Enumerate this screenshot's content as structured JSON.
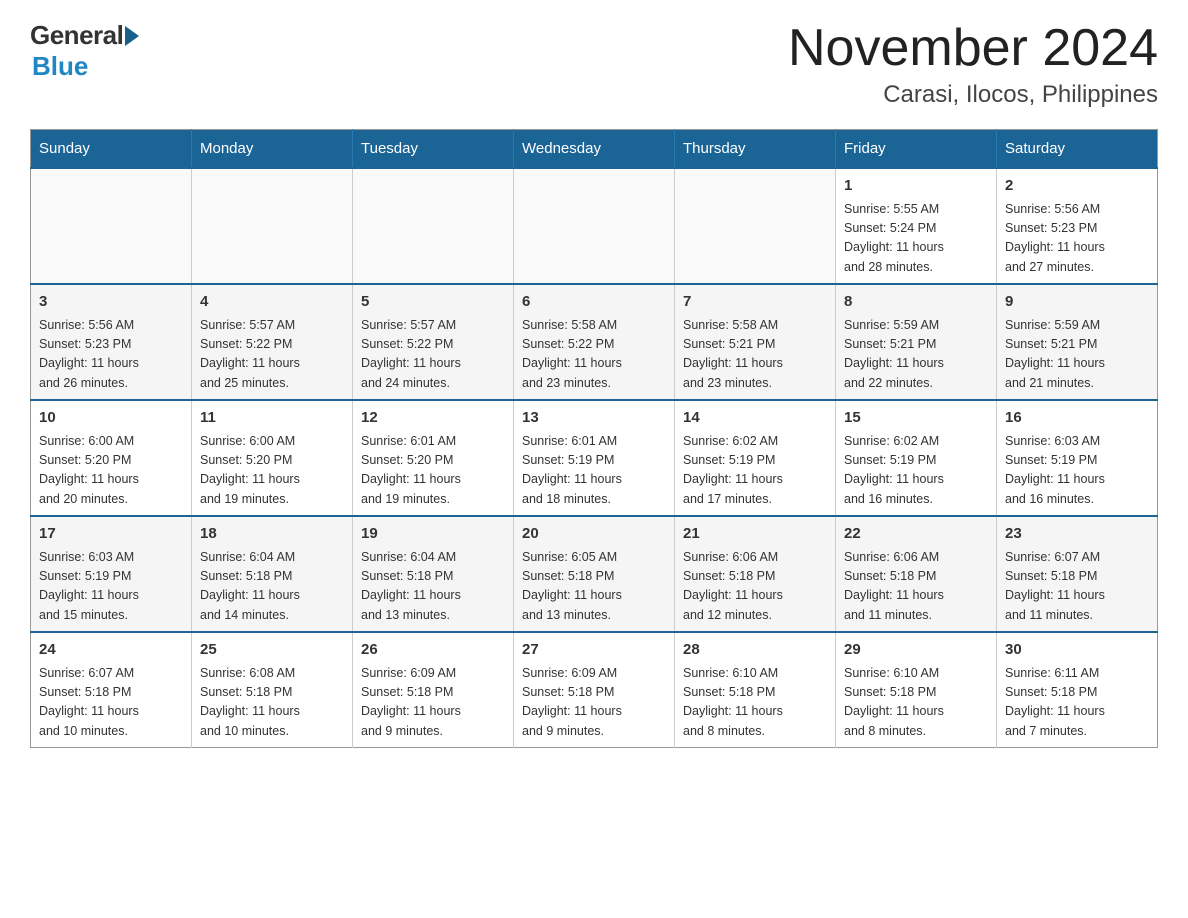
{
  "logo": {
    "general": "General",
    "blue": "Blue"
  },
  "title": {
    "month": "November 2024",
    "location": "Carasi, Ilocos, Philippines"
  },
  "weekdays": [
    "Sunday",
    "Monday",
    "Tuesday",
    "Wednesday",
    "Thursday",
    "Friday",
    "Saturday"
  ],
  "weeks": [
    [
      {
        "day": "",
        "info": ""
      },
      {
        "day": "",
        "info": ""
      },
      {
        "day": "",
        "info": ""
      },
      {
        "day": "",
        "info": ""
      },
      {
        "day": "",
        "info": ""
      },
      {
        "day": "1",
        "info": "Sunrise: 5:55 AM\nSunset: 5:24 PM\nDaylight: 11 hours\nand 28 minutes."
      },
      {
        "day": "2",
        "info": "Sunrise: 5:56 AM\nSunset: 5:23 PM\nDaylight: 11 hours\nand 27 minutes."
      }
    ],
    [
      {
        "day": "3",
        "info": "Sunrise: 5:56 AM\nSunset: 5:23 PM\nDaylight: 11 hours\nand 26 minutes."
      },
      {
        "day": "4",
        "info": "Sunrise: 5:57 AM\nSunset: 5:22 PM\nDaylight: 11 hours\nand 25 minutes."
      },
      {
        "day": "5",
        "info": "Sunrise: 5:57 AM\nSunset: 5:22 PM\nDaylight: 11 hours\nand 24 minutes."
      },
      {
        "day": "6",
        "info": "Sunrise: 5:58 AM\nSunset: 5:22 PM\nDaylight: 11 hours\nand 23 minutes."
      },
      {
        "day": "7",
        "info": "Sunrise: 5:58 AM\nSunset: 5:21 PM\nDaylight: 11 hours\nand 23 minutes."
      },
      {
        "day": "8",
        "info": "Sunrise: 5:59 AM\nSunset: 5:21 PM\nDaylight: 11 hours\nand 22 minutes."
      },
      {
        "day": "9",
        "info": "Sunrise: 5:59 AM\nSunset: 5:21 PM\nDaylight: 11 hours\nand 21 minutes."
      }
    ],
    [
      {
        "day": "10",
        "info": "Sunrise: 6:00 AM\nSunset: 5:20 PM\nDaylight: 11 hours\nand 20 minutes."
      },
      {
        "day": "11",
        "info": "Sunrise: 6:00 AM\nSunset: 5:20 PM\nDaylight: 11 hours\nand 19 minutes."
      },
      {
        "day": "12",
        "info": "Sunrise: 6:01 AM\nSunset: 5:20 PM\nDaylight: 11 hours\nand 19 minutes."
      },
      {
        "day": "13",
        "info": "Sunrise: 6:01 AM\nSunset: 5:19 PM\nDaylight: 11 hours\nand 18 minutes."
      },
      {
        "day": "14",
        "info": "Sunrise: 6:02 AM\nSunset: 5:19 PM\nDaylight: 11 hours\nand 17 minutes."
      },
      {
        "day": "15",
        "info": "Sunrise: 6:02 AM\nSunset: 5:19 PM\nDaylight: 11 hours\nand 16 minutes."
      },
      {
        "day": "16",
        "info": "Sunrise: 6:03 AM\nSunset: 5:19 PM\nDaylight: 11 hours\nand 16 minutes."
      }
    ],
    [
      {
        "day": "17",
        "info": "Sunrise: 6:03 AM\nSunset: 5:19 PM\nDaylight: 11 hours\nand 15 minutes."
      },
      {
        "day": "18",
        "info": "Sunrise: 6:04 AM\nSunset: 5:18 PM\nDaylight: 11 hours\nand 14 minutes."
      },
      {
        "day": "19",
        "info": "Sunrise: 6:04 AM\nSunset: 5:18 PM\nDaylight: 11 hours\nand 13 minutes."
      },
      {
        "day": "20",
        "info": "Sunrise: 6:05 AM\nSunset: 5:18 PM\nDaylight: 11 hours\nand 13 minutes."
      },
      {
        "day": "21",
        "info": "Sunrise: 6:06 AM\nSunset: 5:18 PM\nDaylight: 11 hours\nand 12 minutes."
      },
      {
        "day": "22",
        "info": "Sunrise: 6:06 AM\nSunset: 5:18 PM\nDaylight: 11 hours\nand 11 minutes."
      },
      {
        "day": "23",
        "info": "Sunrise: 6:07 AM\nSunset: 5:18 PM\nDaylight: 11 hours\nand 11 minutes."
      }
    ],
    [
      {
        "day": "24",
        "info": "Sunrise: 6:07 AM\nSunset: 5:18 PM\nDaylight: 11 hours\nand 10 minutes."
      },
      {
        "day": "25",
        "info": "Sunrise: 6:08 AM\nSunset: 5:18 PM\nDaylight: 11 hours\nand 10 minutes."
      },
      {
        "day": "26",
        "info": "Sunrise: 6:09 AM\nSunset: 5:18 PM\nDaylight: 11 hours\nand 9 minutes."
      },
      {
        "day": "27",
        "info": "Sunrise: 6:09 AM\nSunset: 5:18 PM\nDaylight: 11 hours\nand 9 minutes."
      },
      {
        "day": "28",
        "info": "Sunrise: 6:10 AM\nSunset: 5:18 PM\nDaylight: 11 hours\nand 8 minutes."
      },
      {
        "day": "29",
        "info": "Sunrise: 6:10 AM\nSunset: 5:18 PM\nDaylight: 11 hours\nand 8 minutes."
      },
      {
        "day": "30",
        "info": "Sunrise: 6:11 AM\nSunset: 5:18 PM\nDaylight: 11 hours\nand 7 minutes."
      }
    ]
  ]
}
